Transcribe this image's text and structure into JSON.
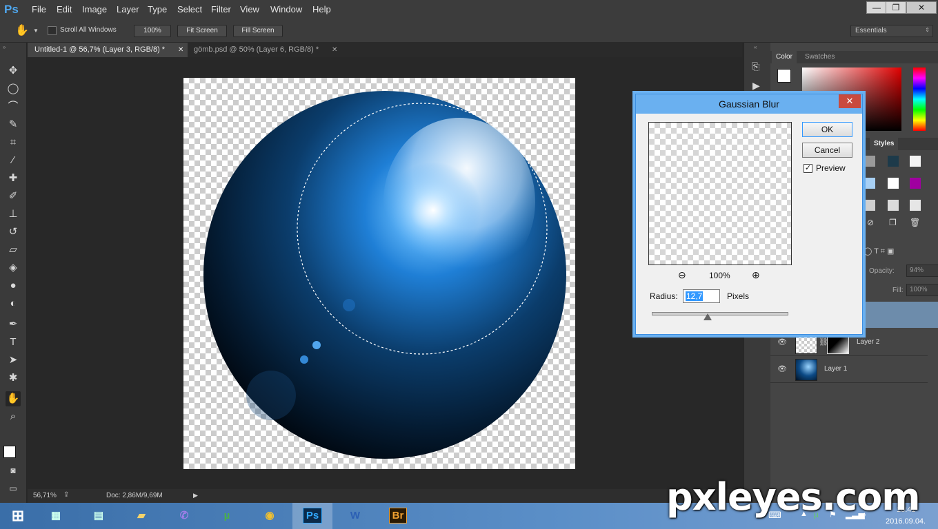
{
  "app": {
    "logo": "Ps"
  },
  "menu": [
    "File",
    "Edit",
    "Image",
    "Layer",
    "Type",
    "Select",
    "Filter",
    "View",
    "Window",
    "Help"
  ],
  "window_buttons": {
    "minimize": "—",
    "restore": "❐",
    "close": "✕"
  },
  "options_bar": {
    "scroll_all_windows": "Scroll All Windows",
    "zoom_100": "100%",
    "fit_screen": "Fit Screen",
    "fill_screen": "Fill Screen",
    "workspace": "Essentials"
  },
  "tabs": [
    {
      "label": "Untitled-1 @ 56,7% (Layer 3, RGB/8) *",
      "active": true
    },
    {
      "label": "gömb.psd @ 50% (Layer 6, RGB/8) *",
      "active": false
    }
  ],
  "status": {
    "zoom": "56,71%",
    "doc": "Doc: 2,86M/9,69M"
  },
  "panels": {
    "color_tab": "Color",
    "swatches_tab": "Swatches",
    "styles_tab": "Styles",
    "opacity_label": "Opacity:",
    "opacity_value": "94%",
    "fill_label": "Fill:",
    "fill_value": "100%"
  },
  "layers": [
    {
      "name": "Layer 2"
    },
    {
      "name": "Layer 1"
    }
  ],
  "dialog": {
    "title": "Gaussian Blur",
    "ok": "OK",
    "cancel": "Cancel",
    "preview_label": "Preview",
    "preview_checked": true,
    "zoom": "100%",
    "radius_label": "Radius:",
    "radius_value": "12,7",
    "radius_unit": "Pixels"
  },
  "taskbar": {
    "apps": [
      "Ps",
      "Br"
    ],
    "time": "18:41",
    "date": "2016.09.04."
  },
  "watermark": "pxleyes.com",
  "colors": {
    "accent": "#6ab0f0",
    "panel_bg": "#454545",
    "ui_bg": "#3c3c3c",
    "sphere_dark": "#02101e",
    "sphere_light": "#3a9ae8"
  }
}
